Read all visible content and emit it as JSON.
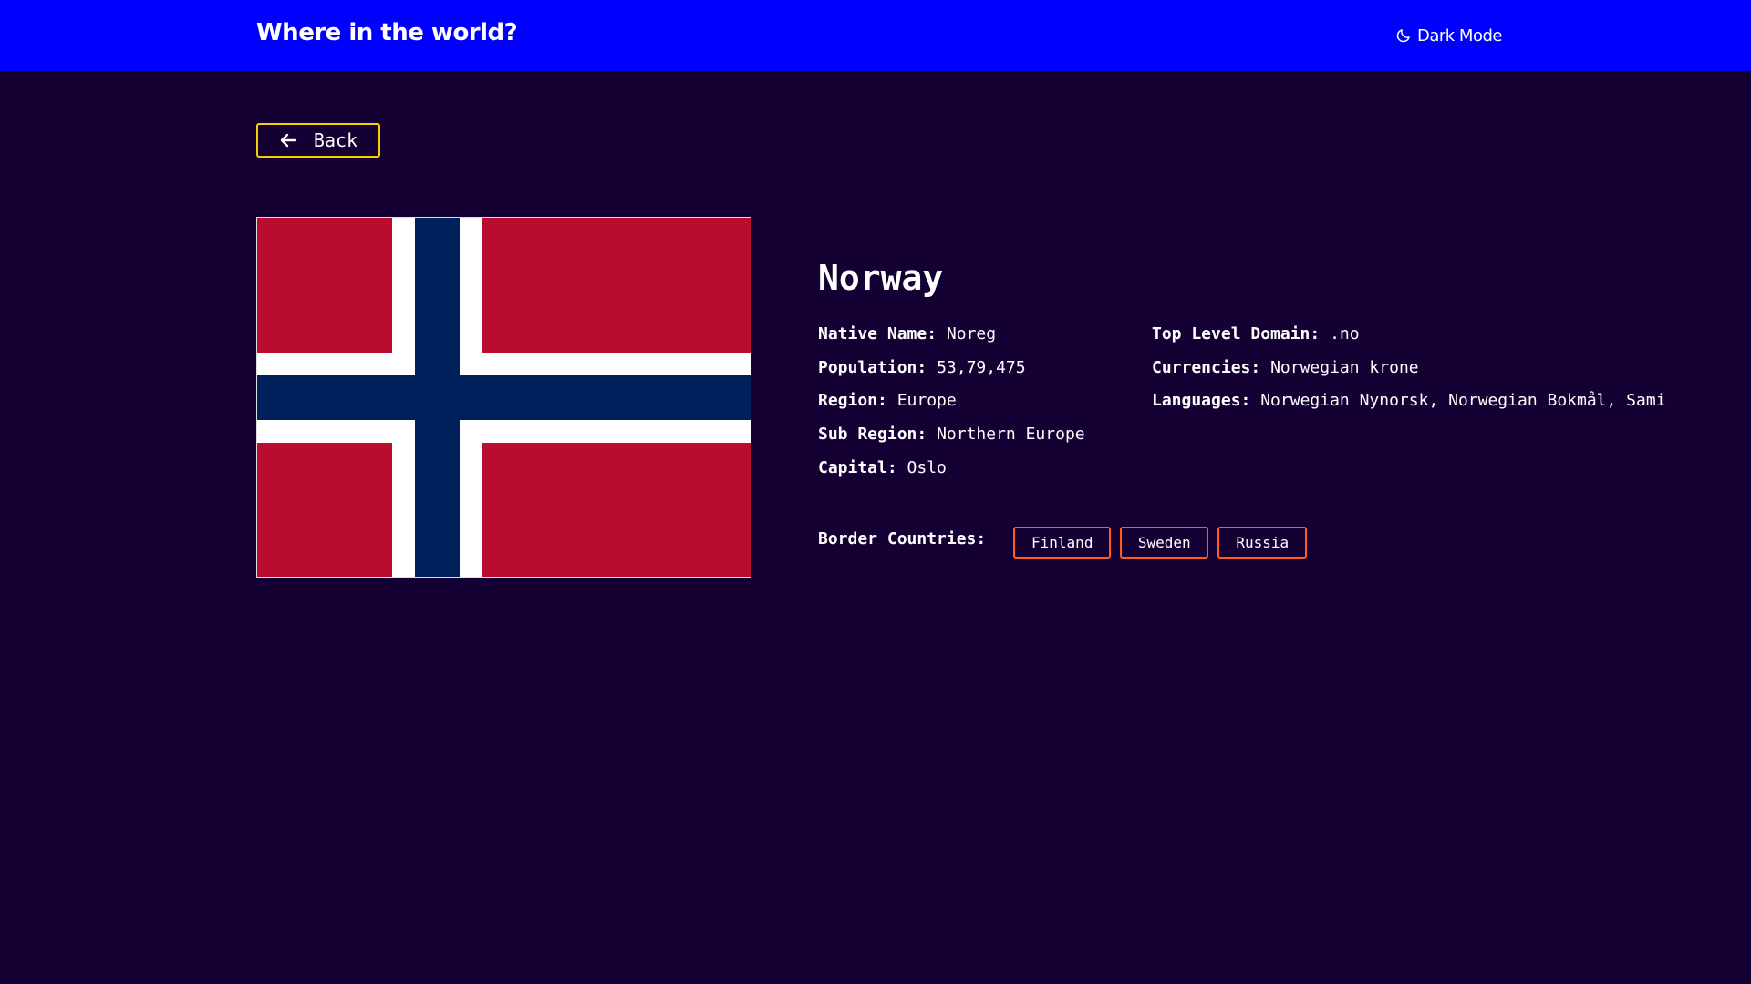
{
  "header": {
    "title": "Where in the world?",
    "dark_mode_label": "Dark Mode",
    "background_color": "#0000ff",
    "dark_mode_icon": "moon-icon"
  },
  "page": {
    "background_color": "#140033"
  },
  "back_button": {
    "label": "Back",
    "icon": "arrow-left-icon",
    "border_color": "#f5d000"
  },
  "country": {
    "name": "Norway",
    "flag": {
      "name": "flag of Norway",
      "colors": [
        "#ba0c2f",
        "#ffffff",
        "#00205b"
      ]
    },
    "details_left": [
      {
        "label": "Native Name:",
        "value": "Noreg"
      },
      {
        "label": "Population:",
        "value": "53,79,475"
      },
      {
        "label": "Region:",
        "value": "Europe"
      },
      {
        "label": "Sub Region:",
        "value": "Northern Europe"
      },
      {
        "label": "Capital:",
        "value": "Oslo"
      }
    ],
    "details_right": [
      {
        "label": "Top Level Domain:",
        "value": ".no"
      },
      {
        "label": "Currencies:",
        "value": "Norwegian krone"
      },
      {
        "label": "Languages:",
        "value": "Norwegian Nynorsk, Norwegian Bokmål, Sami"
      }
    ],
    "border_countries_label": "Border Countries:",
    "border_countries": [
      "Finland",
      "Sweden",
      "Russia"
    ],
    "border_chip_color": "#ff5a1f"
  }
}
